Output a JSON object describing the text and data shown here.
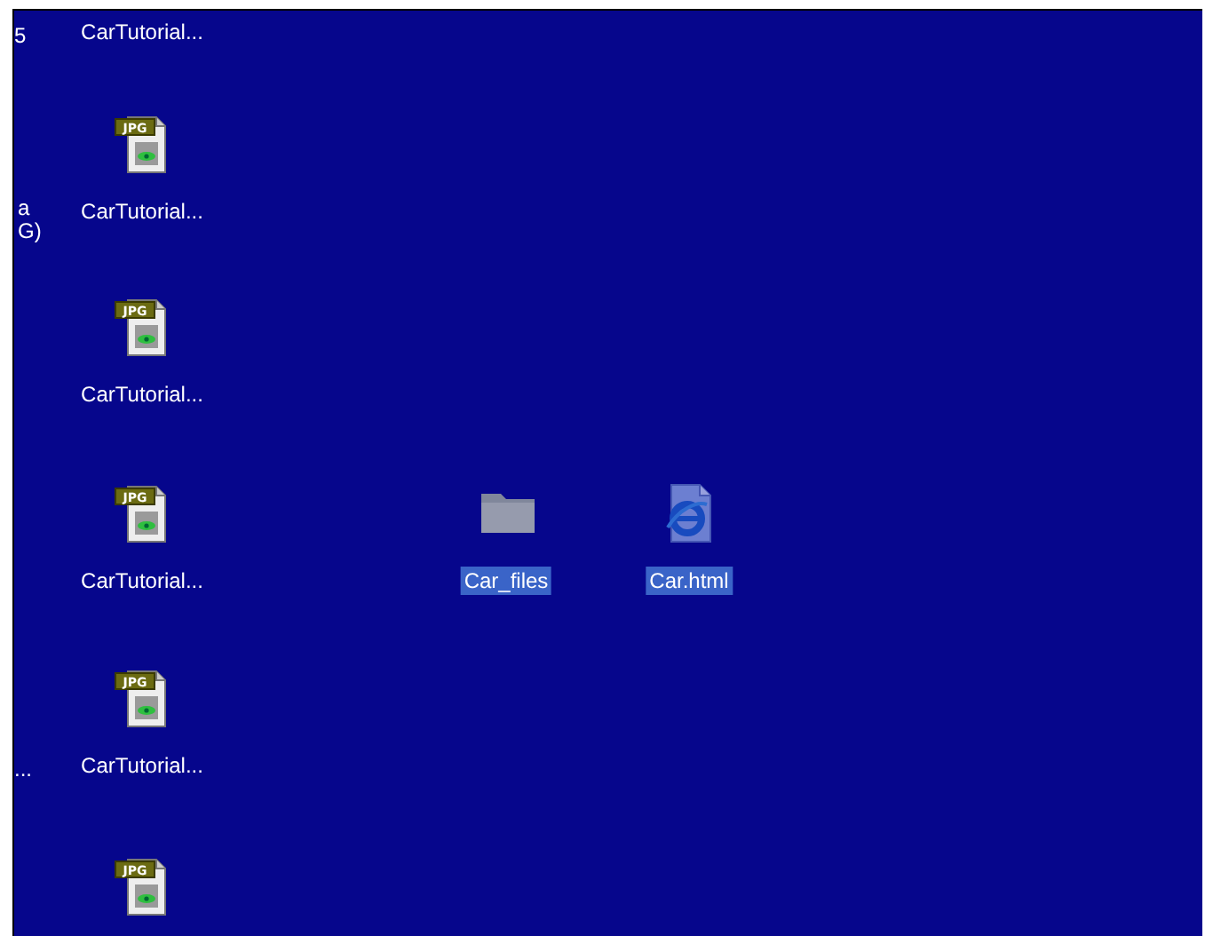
{
  "desktop": {
    "cut_off_labels": [
      {
        "text": "5"
      },
      {
        "text": "a"
      },
      {
        "text": "G)"
      },
      {
        "text": "..."
      }
    ],
    "icons": [
      {
        "kind": "label",
        "label": "CarTutorial...",
        "selected": false
      },
      {
        "kind": "jpg",
        "tag": "JPG",
        "label": "CarTutorial...",
        "selected": false
      },
      {
        "kind": "jpg",
        "tag": "JPG",
        "label": "CarTutorial...",
        "selected": false
      },
      {
        "kind": "jpg",
        "tag": "JPG",
        "label": "CarTutorial...",
        "selected": false
      },
      {
        "kind": "jpg",
        "tag": "JPG",
        "label": "CarTutorial...",
        "selected": false
      },
      {
        "kind": "jpg",
        "tag": "JPG",
        "selected": false
      },
      {
        "kind": "folder",
        "label": "Car_files",
        "selected": true
      },
      {
        "kind": "html",
        "label": "Car.html",
        "selected": true
      }
    ]
  }
}
